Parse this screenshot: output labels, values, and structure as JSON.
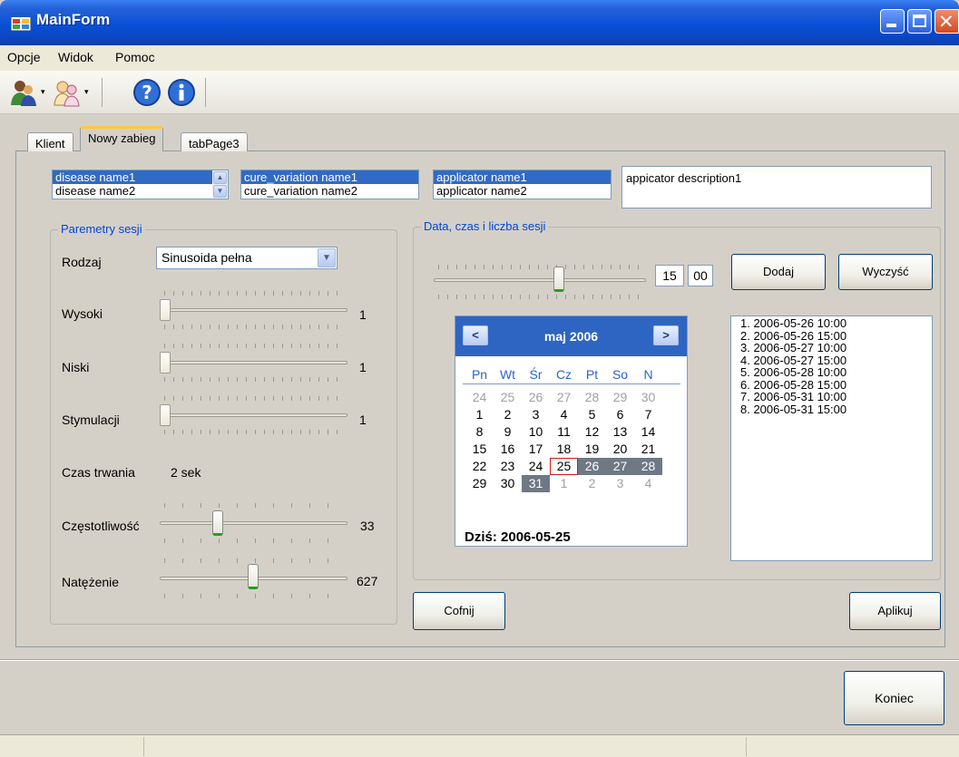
{
  "window": {
    "title": "MainForm"
  },
  "menu": {
    "items": [
      "Opcje",
      "Widok",
      "Pomoc"
    ]
  },
  "toolbar": {
    "icons": [
      "users-icon",
      "user-group-icon",
      "help-icon",
      "info-icon"
    ],
    "dropdown_glyph": "▾"
  },
  "tabs": [
    "Klient",
    "Nowy zabieg",
    "tabPage3"
  ],
  "lists": {
    "disease": [
      "disease name1",
      "disease name2"
    ],
    "cure": [
      "cure_variation name1",
      "cure_variation name2"
    ],
    "applicator": [
      "applicator name1",
      "applicator name2"
    ],
    "applicator_description": "appicator description1",
    "scroll_up": "▲",
    "scroll_down": "▼"
  },
  "params": {
    "title": "Paremetry sesji",
    "rodzaj_label": "Rodzaj",
    "rodzaj_value": "Sinusoida pełna",
    "combo_arrow": "▼",
    "wysoki_label": "Wysoki",
    "wysoki_value": "1",
    "niski_label": "Niski",
    "niski_value": "1",
    "stymulacji_label": "Stymulacji",
    "stymulacji_value": "1",
    "czas_label": "Czas trwania",
    "czas_value": "2 sek",
    "czestotliwosc_label": "Częstotliwość",
    "czestotliwosc_value": "33",
    "natezenie_label": "Natężenie",
    "natezenie_value": "627",
    "sliders": {
      "wysoki": 0,
      "niski": 0,
      "stymulacji": 0,
      "czestotliwosc": 0.3,
      "natezenie": 0.5
    }
  },
  "date": {
    "title": "Data, czas i liczba sesji",
    "hour": "15",
    "minute": "00",
    "time_slider": 0.6,
    "add_label": "Dodaj",
    "clear_label": "Wyczyść"
  },
  "calendar": {
    "prev": "<",
    "next": ">",
    "month": "maj 2006",
    "days_of_week": [
      "Pn",
      "Wt",
      "Śr",
      "Cz",
      "Pt",
      "So",
      "N"
    ],
    "weeks": [
      [
        "24",
        "25",
        "26",
        "27",
        "28",
        "29",
        "30"
      ],
      [
        "1",
        "2",
        "3",
        "4",
        "5",
        "6",
        "7"
      ],
      [
        "8",
        "9",
        "10",
        "11",
        "12",
        "13",
        "14"
      ],
      [
        "15",
        "16",
        "17",
        "18",
        "19",
        "20",
        "21"
      ],
      [
        "22",
        "23",
        "24",
        "25",
        "26",
        "27",
        "28"
      ],
      [
        "29",
        "30",
        "31",
        "1",
        "2",
        "3",
        "4"
      ]
    ],
    "today_text": "Dziś: 2006-05-25"
  },
  "sessions": [
    "1. 2006-05-26 10:00",
    "2. 2006-05-26 15:00",
    "3. 2006-05-27 10:00",
    "4. 2006-05-27 15:00",
    "5. 2006-05-28 10:00",
    "6. 2006-05-28 15:00",
    "7. 2006-05-31 10:00",
    "8. 2006-05-31 15:00"
  ],
  "buttons": {
    "cofnij": "Cofnij",
    "aplikuj": "Aplikuj",
    "koniec": "Koniec"
  },
  "colors": {
    "titlebar": "#0a4fd6",
    "selection": "#316ac5",
    "calendar_header": "#2e65c2",
    "group_title": "#0046d5"
  }
}
